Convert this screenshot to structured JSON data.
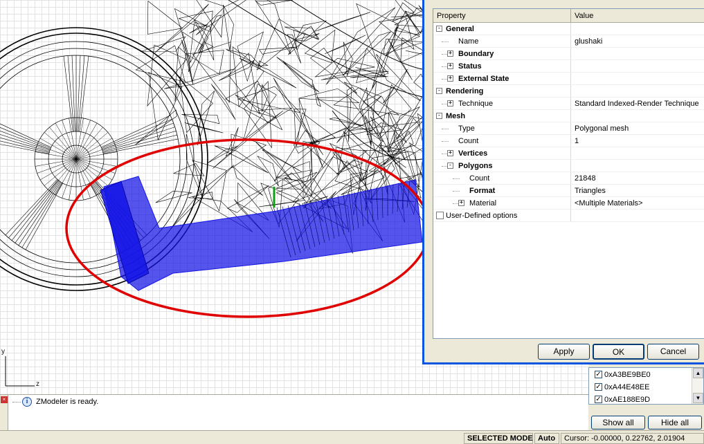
{
  "viewport": {
    "axis_y": "y",
    "axis_z": "z"
  },
  "properties": {
    "header": {
      "property": "Property",
      "value": "Value"
    },
    "rows": [
      {
        "label": "General",
        "value": "",
        "level": 0,
        "bold": true,
        "expander": "−"
      },
      {
        "label": "Name",
        "value": "glushaki",
        "level": 1,
        "bold": false,
        "expander": ""
      },
      {
        "label": "Boundary",
        "value": "",
        "level": 1,
        "bold": true,
        "expander": "+"
      },
      {
        "label": "Status",
        "value": "",
        "level": 1,
        "bold": true,
        "expander": "+"
      },
      {
        "label": "External State",
        "value": "",
        "level": 1,
        "bold": true,
        "expander": "+"
      },
      {
        "label": "Rendering",
        "value": "",
        "level": 0,
        "bold": true,
        "expander": "−"
      },
      {
        "label": "Technique",
        "value": "Standard Indexed-Render Technique",
        "level": 1,
        "bold": false,
        "expander": "+"
      },
      {
        "label": "Mesh",
        "value": "",
        "level": 0,
        "bold": true,
        "expander": "−"
      },
      {
        "label": "Type",
        "value": "Polygonal mesh",
        "level": 1,
        "bold": false,
        "expander": ""
      },
      {
        "label": "Count",
        "value": "1",
        "level": 1,
        "bold": false,
        "expander": ""
      },
      {
        "label": "Vertices",
        "value": "",
        "level": 1,
        "bold": true,
        "expander": "+"
      },
      {
        "label": "Polygons",
        "value": "",
        "level": 1,
        "bold": true,
        "expander": "−"
      },
      {
        "label": "Count",
        "value": "21848",
        "level": 2,
        "bold": false,
        "expander": ""
      },
      {
        "label": "Format",
        "value": "Triangles",
        "level": 2,
        "bold": true,
        "expander": ""
      },
      {
        "label": "Material",
        "value": "<Multiple Materials>",
        "level": 2,
        "bold": false,
        "expander": "+"
      },
      {
        "label": "User-Defined options",
        "value": "",
        "level": 0,
        "bold": false,
        "expander": "checkbox"
      }
    ]
  },
  "buttons": {
    "apply": "Apply",
    "ok": "OK",
    "cancel": "Cancel"
  },
  "hash_list": {
    "items": [
      "0xA3BE9BE0",
      "0xA44E48EE",
      "0xAE188E9D"
    ],
    "show_all": "Show all",
    "hide_all": "Hide all"
  },
  "log": {
    "message": "ZModeler is ready."
  },
  "status": {
    "mode": "SELECTED MODE",
    "auto": "Auto",
    "cursor": "Cursor: -0.00000, 0.22762, 2.01904"
  },
  "colors": {
    "accent": "#0a54e0",
    "mesh_selected": "#1414e6",
    "highlight": "#e00000"
  }
}
